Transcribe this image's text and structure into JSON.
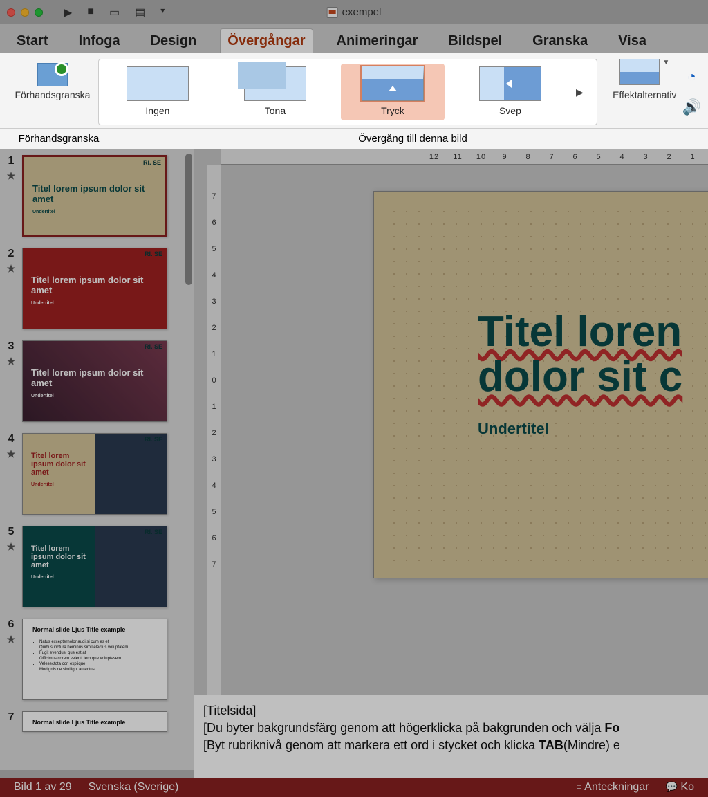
{
  "title": "exempel",
  "tabs": {
    "start": "Start",
    "infoga": "Infoga",
    "design": "Design",
    "overgangar": "Övergångar",
    "animeringar": "Animeringar",
    "bildspel": "Bildspel",
    "granska": "Granska",
    "visa": "Visa"
  },
  "ribbon": {
    "preview_label": "Förhandsgranska",
    "preview_caption": "Förhandsgranska",
    "transitions": {
      "none": "Ingen",
      "fade": "Tona",
      "push": "Tryck",
      "wipe": "Svep"
    },
    "effect_options": "Effektalternativ",
    "section_caption": "Övergång till denna bild"
  },
  "slides": {
    "s1": {
      "num": "1",
      "title": "Titel lorem ipsum dolor sit amet",
      "sub": "Undertitel",
      "logo": "RI.\nSE"
    },
    "s2": {
      "num": "2",
      "title": "Titel lorem ipsum dolor sit amet",
      "sub": "Undertitel",
      "logo": "RI.\nSE"
    },
    "s3": {
      "num": "3",
      "title": "Titel lorem ipsum dolor sit amet",
      "sub": "Undertitel",
      "logo": "RI.\nSE"
    },
    "s4": {
      "num": "4",
      "title": "Titel lorem ipsum dolor sit amet",
      "sub": "Undertitel",
      "logo": "RI.\nSE"
    },
    "s5": {
      "num": "5",
      "title": "Titel lorem ipsum dolor sit amet",
      "sub": "Undertitel",
      "logo": "RI.\nSE"
    },
    "s6": {
      "num": "6",
      "title": "Normal slide Ljus Title example",
      "b1": "Natus excepternolor audi si cum es et",
      "b2": "Quibus inctura heminus simil electus voluptatem",
      "b3": "Fugit evendus, que est at",
      "b4": "Officimus corem velent, tem que voluptasem",
      "b5": "Velesectota con explique",
      "b6": "Modignis ne similigni autectus"
    },
    "s7": {
      "num": "7",
      "title": "Normal slide Ljus Title example"
    }
  },
  "canvas": {
    "title_l1": "Titel loren",
    "title_l2": "dolor sit c",
    "subtitle": "Undertitel"
  },
  "ruler_h": [
    "12",
    "11",
    "10",
    "9",
    "8",
    "7",
    "6",
    "5",
    "4",
    "3",
    "2",
    "1"
  ],
  "ruler_v": [
    "7",
    "6",
    "5",
    "4",
    "3",
    "2",
    "1",
    "0",
    "1",
    "2",
    "3",
    "4",
    "5",
    "6",
    "7"
  ],
  "notes": {
    "l1": "[Titelsida]",
    "l2a": "[Du byter bakgrundsfärg genom att högerklicka på bakgrunden och välja ",
    "l2b": "Fo",
    "l3a": "[Byt rubriknivå genom att markera ett ord i stycket och klicka ",
    "l3b": "TAB",
    "l3c": "(Mindre) e"
  },
  "status": {
    "slide": "Bild 1 av 29",
    "lang": "Svenska (Sverige)",
    "notes": "Anteckningar",
    "comments": "Ko"
  }
}
